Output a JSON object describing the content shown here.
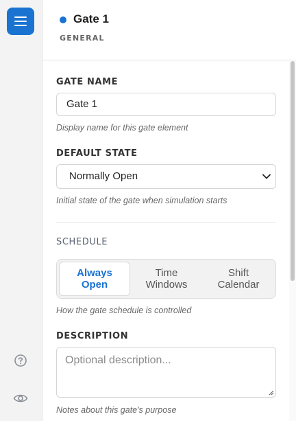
{
  "header": {
    "title": "Gate 1",
    "subtitle": "GENERAL",
    "status_dot_color": "#1a73d1"
  },
  "rail": {
    "menu_icon": "hamburger-menu-icon",
    "help_icon": "question-circle-icon",
    "view_icon": "eye-icon"
  },
  "form": {
    "gate_name": {
      "label": "GATE NAME",
      "value": "Gate 1",
      "help": "Display name for this gate element"
    },
    "default_state": {
      "label": "DEFAULT STATE",
      "selected": "Normally Open",
      "help": "Initial state of the gate when simulation starts"
    },
    "schedule": {
      "label": "SCHEDULE",
      "options": [
        {
          "line1": "Always",
          "line2": "Open",
          "active": true
        },
        {
          "line1": "Time",
          "line2": "Windows",
          "active": false
        },
        {
          "line1": "Shift",
          "line2": "Calendar",
          "active": false
        }
      ],
      "help": "How the gate schedule is controlled"
    },
    "description": {
      "label": "DESCRIPTION",
      "placeholder": "Optional description...",
      "help": "Notes about this gate's purpose"
    }
  },
  "colors": {
    "accent": "#1a73d1"
  }
}
